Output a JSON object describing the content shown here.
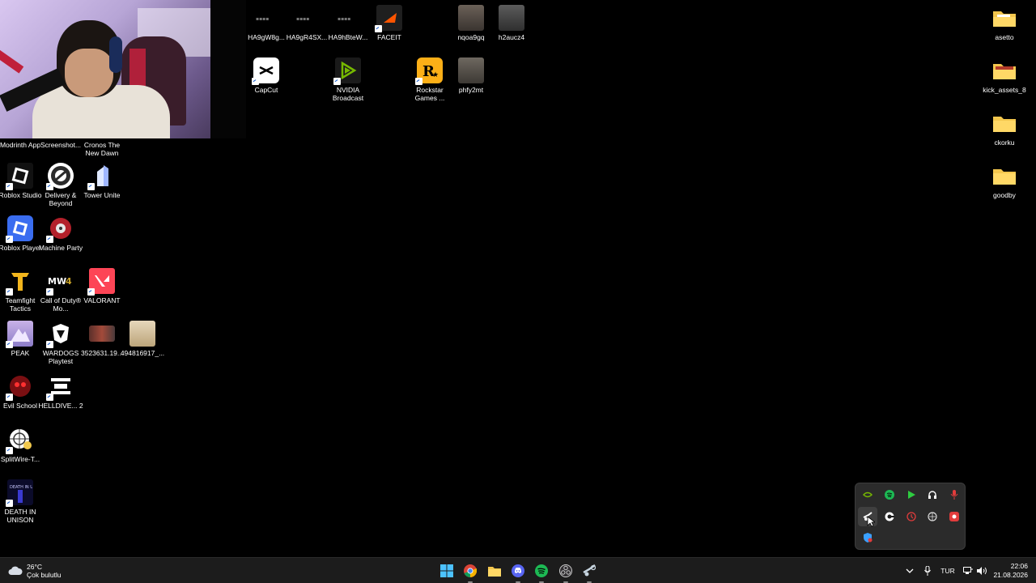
{
  "desktop_icons": [
    {
      "label": "HA9gW8g...",
      "icon": "image-file-icon",
      "shortcut": false
    },
    {
      "label": "HA9gR4SX...",
      "icon": "image-file-icon",
      "shortcut": false
    },
    {
      "label": "HA9hBteW...",
      "icon": "image-file-icon",
      "shortcut": false
    },
    {
      "label": "FACEIT",
      "icon": "faceit-icon",
      "shortcut": true
    },
    {
      "label": "nqoa9gq",
      "icon": "photo-file-icon",
      "shortcut": false
    },
    {
      "label": "h2aucz4",
      "icon": "photo-file-icon",
      "shortcut": false
    },
    {
      "label": "CapCut",
      "icon": "capcut-icon",
      "shortcut": true
    },
    {
      "label": "NVIDIA Broadcast",
      "icon": "nvidia-broadcast-icon",
      "shortcut": true
    },
    {
      "label": "Rockstar Games ...",
      "icon": "rockstar-icon",
      "shortcut": true
    },
    {
      "label": "phfy2mt",
      "icon": "photo-file-icon",
      "shortcut": false
    },
    {
      "label": "asetto",
      "icon": "folder-icon",
      "shortcut": false
    },
    {
      "label": "kick_assets_8",
      "icon": "folder-icon",
      "shortcut": false
    },
    {
      "label": "ckorku",
      "icon": "folder-icon",
      "shortcut": false
    },
    {
      "label": "goodby",
      "icon": "folder-icon",
      "shortcut": false
    },
    {
      "label": "Modrinth App",
      "icon": "modrinth-icon",
      "shortcut": true
    },
    {
      "label": "Screenshot...",
      "icon": "screenshot-file-icon",
      "shortcut": false
    },
    {
      "label": "Cronos The New Dawn",
      "icon": "cronos-icon",
      "shortcut": true
    },
    {
      "label": "Roblox Studio",
      "icon": "roblox-studio-icon",
      "shortcut": true
    },
    {
      "label": "Delivery & Beyond",
      "icon": "delivery-beyond-icon",
      "shortcut": true
    },
    {
      "label": "Tower Unite",
      "icon": "tower-unite-icon",
      "shortcut": true
    },
    {
      "label": "Roblox Player",
      "icon": "roblox-player-icon",
      "shortcut": true
    },
    {
      "label": "Machine Party",
      "icon": "machine-party-icon",
      "shortcut": true
    },
    {
      "label": "Teamfight Tactics",
      "icon": "teamfight-tactics-icon",
      "shortcut": true
    },
    {
      "label": "Call of Duty® Mo...",
      "icon": "call-of-duty-icon",
      "shortcut": true
    },
    {
      "label": "VALORANT",
      "icon": "valorant-icon",
      "shortcut": true
    },
    {
      "label": "PEAK",
      "icon": "peak-icon",
      "shortcut": true
    },
    {
      "label": "WARDOGS Playtest",
      "icon": "wardogs-icon",
      "shortcut": true
    },
    {
      "label": "3523631.19...",
      "icon": "photo-file-icon",
      "shortcut": false
    },
    {
      "label": "494816917_...",
      "icon": "photo-file-icon",
      "shortcut": false
    },
    {
      "label": "Evil School",
      "icon": "evil-school-icon",
      "shortcut": true
    },
    {
      "label": "HELLDIVE... 2",
      "icon": "helldivers-icon",
      "shortcut": true
    },
    {
      "label": "SplitWire-T...",
      "icon": "splitwire-icon",
      "shortcut": true
    },
    {
      "label": "DEATH IN UNISON",
      "icon": "death-in-unison-icon",
      "shortcut": true
    }
  ],
  "tray_popup_icons": [
    {
      "name": "nvidia-tray-icon",
      "color": "#76b900"
    },
    {
      "name": "spotify-tray-icon",
      "color": "#1db954"
    },
    {
      "name": "play-tray-icon",
      "color": "#2ecc40"
    },
    {
      "name": "headset-tray-icon",
      "color": "#ffffff"
    },
    {
      "name": "microphone-tray-icon",
      "color": "#e23c3c"
    },
    {
      "name": "steam-tray-icon",
      "color": "#ffffff"
    },
    {
      "name": "epic-tray-icon",
      "color": "#ffffff"
    },
    {
      "name": "recorder-tray-icon",
      "color": "#e23c3c"
    },
    {
      "name": "network-tray-icon",
      "color": "#dddddd"
    },
    {
      "name": "record-tray-icon",
      "color": "#e23c3c"
    },
    {
      "name": "defender-tray-icon",
      "color": "#3aa0ff"
    }
  ],
  "taskbar": {
    "weather": {
      "temp": "26°C",
      "condition": "Çok bulutlu"
    },
    "apps": [
      "start-icon",
      "chrome-icon",
      "file-explorer-icon",
      "discord-icon",
      "spotify-icon",
      "obs-icon",
      "steam-icon"
    ],
    "tray": {
      "language": "TUR"
    },
    "clock": {
      "time": "22:06",
      "date": "21.08.2026"
    }
  }
}
